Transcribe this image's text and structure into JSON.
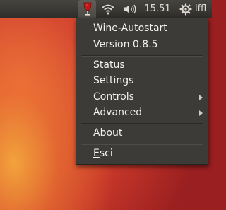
{
  "topbar": {
    "icons": [
      "wine-glass-icon",
      "wifi-icon",
      "volume-icon",
      "settings-gear-icon"
    ],
    "clock": "15.51",
    "user": "lffl"
  },
  "menu": {
    "items": [
      {
        "label": "Wine-Autostart",
        "submenu": false
      },
      {
        "label": "Version 0.8.5",
        "submenu": false
      },
      {
        "label": "Status",
        "submenu": false
      },
      {
        "label": "Settings",
        "submenu": false
      },
      {
        "label": "Controls",
        "submenu": true
      },
      {
        "label": "Advanced",
        "submenu": true
      },
      {
        "label": "About",
        "submenu": false
      },
      {
        "label": "Esci",
        "submenu": false,
        "mnemonic": "E"
      }
    ]
  },
  "colors": {
    "panel": "#3c3b37",
    "menu_text": "#f2f1ef",
    "wallpaper_orange": "#e8643a",
    "wallpaper_red": "#c8382a",
    "wine_red": "#c0181b"
  }
}
